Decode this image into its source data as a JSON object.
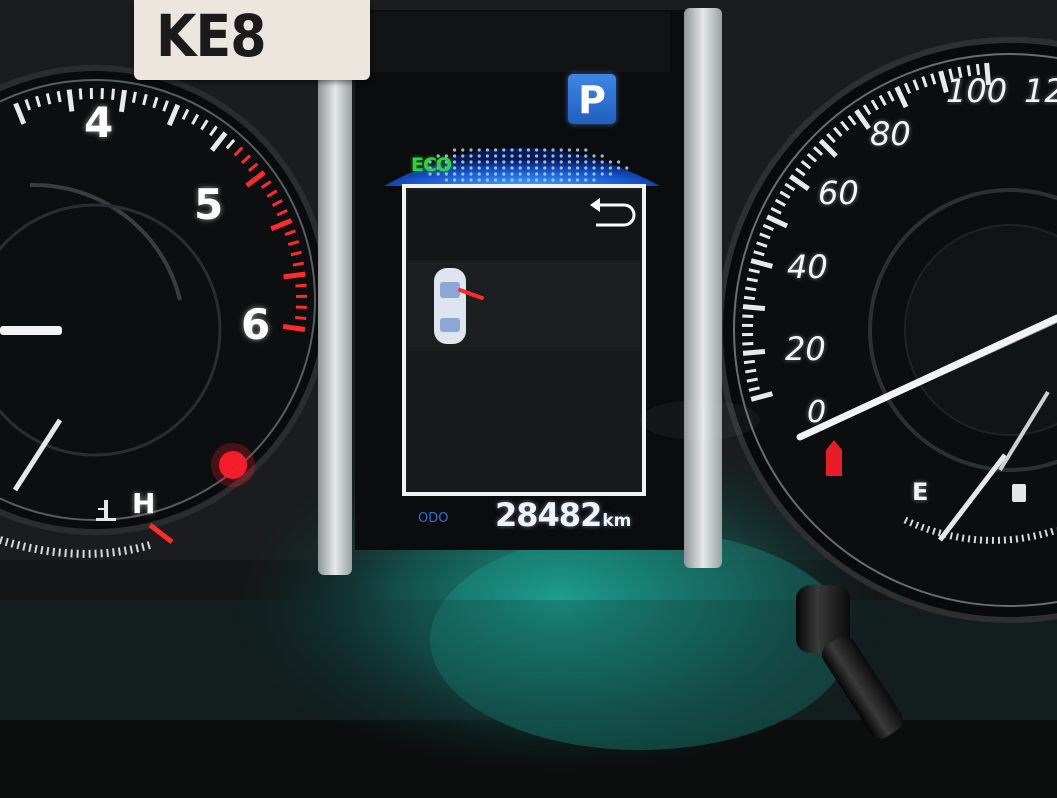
{
  "tag": "KE8",
  "gear": "P",
  "mode": "ECO",
  "odometer": {
    "label": "ODO",
    "value": "28482",
    "unit": "km"
  },
  "tachometer": {
    "tick_labels": [
      "4",
      "5",
      "6"
    ],
    "temp_label": "H"
  },
  "speedometer": {
    "tick_labels": [
      "0",
      "20",
      "40",
      "60",
      "80",
      "100",
      "12"
    ],
    "fuel_label": "E"
  },
  "colors": {
    "accent_blue": "#2f7ff0",
    "eco_green": "#34d13b",
    "warning_red": "#ff2a2a",
    "display_frame": "#f2f2f2"
  }
}
